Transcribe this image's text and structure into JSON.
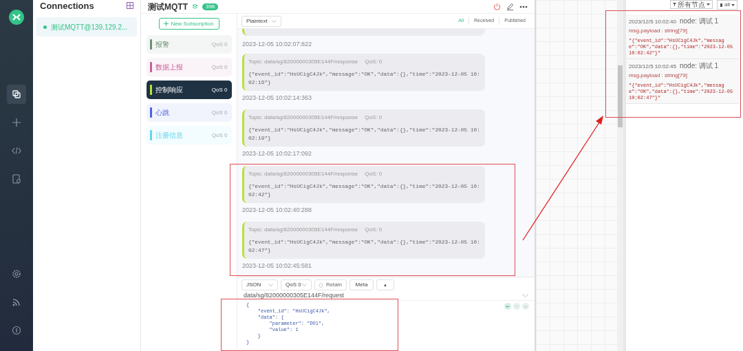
{
  "nav": {
    "items": [
      {
        "kind": "connections",
        "selected": true
      },
      {
        "kind": "new",
        "selected": false
      },
      {
        "kind": "script",
        "selected": false
      },
      {
        "kind": "log",
        "selected": false
      },
      {
        "kind": "settings",
        "selected": false
      },
      {
        "kind": "feed",
        "selected": false
      },
      {
        "kind": "about",
        "selected": false
      }
    ]
  },
  "connections": {
    "title": "Connections",
    "items": [
      {
        "name": "测试MQTT@139.129.2...",
        "connected": true,
        "selected": true
      }
    ]
  },
  "connection_header": {
    "title": "测试MQTT",
    "message_count": "396"
  },
  "subscriptions": {
    "new_button": "New Subscription",
    "items": [
      {
        "topic": "报警",
        "qos": "QoS 0",
        "color": "#6b8f71",
        "selected": false
      },
      {
        "topic": "数据上报",
        "qos": "QoS 0",
        "color": "#c5609a",
        "selected": false
      },
      {
        "topic": "控制响应",
        "qos": "QoS 0",
        "color": "#b5e23a",
        "selected": true
      },
      {
        "topic": "心跳",
        "qos": "QoS 0",
        "color": "#4b63e0",
        "selected": false
      },
      {
        "topic": "注册信息",
        "qos": "QoS 0",
        "color": "#62d4f2",
        "selected": false
      }
    ]
  },
  "message_filter": {
    "format": "Plaintext",
    "tabs": [
      {
        "label": "All",
        "selected": true
      },
      {
        "label": "Received",
        "selected": false
      },
      {
        "label": "Published",
        "selected": false
      }
    ]
  },
  "earlier_message_time": "2023-12-05 10:02:07:822",
  "messages": [
    {
      "topic": "Topic: data/sg/82000000305E144F/response",
      "qos": "QoS: 0",
      "payload": "{\"event_id\":\"HsUCigC4Jk\",\"message\":\"OK\",\"data\":{},\"time\":\"2023-12-05 10:02:16\"}",
      "time": "2023-12-05 10:02:14:363"
    },
    {
      "topic": "Topic: data/sg/82000000305E144F/response",
      "qos": "QoS: 0",
      "payload": "{\"event_id\":\"HsUCigC4Jk\",\"message\":\"OK\",\"data\":{},\"time\":\"2023-12-05 10:02:19\"}",
      "time": "2023-12-05 10:02:17:092"
    },
    {
      "topic": "Topic: data/sg/82000000305E144F/response",
      "qos": "QoS: 0",
      "payload": "{\"event_id\":\"HsUCigC4Jk\",\"message\":\"OK\",\"data\":{},\"time\":\"2023-12-05 10:02:42\"}",
      "time": "2023-12-05 10:02:40:288"
    },
    {
      "topic": "Topic: data/sg/82000000305E144F/response",
      "qos": "QoS: 0",
      "payload": "{\"event_id\":\"HsUCigC4Jk\",\"message\":\"OK\",\"data\":{},\"time\":\"2023-12-05 10:02:47\"}",
      "time": "2023-12-05 10:02:45:581"
    }
  ],
  "composer": {
    "format": "JSON",
    "qos": "QoS 0",
    "retain": {
      "label": "Retain",
      "checked": false
    },
    "meta_button": "Meta",
    "toggle_button": "▲",
    "topic": "data/sg/82000000305E144F/request",
    "code_lines": [
      "{",
      "    \"event_id\": \"HsUCigC4Jk\",",
      "    \"data\": {",
      "        \"parameter\": \"DO1\",",
      "        \"value\": 1",
      "    }",
      "}"
    ]
  },
  "debug_panel": {
    "filter_button": "所有节点",
    "clear_button": "all",
    "entries": [
      {
        "date": "2023/12/5 10:02:40",
        "node": "node: 调试 1",
        "type": "msg.payload : string[79]",
        "payload": "\"{\"event_id\":\"HsUCigC4Jk\",\"message\":\"OK\",\"data\":{},\"time\":\"2023-12-05 10:02:42\"}\""
      },
      {
        "date": "2023/12/5 10:02:45",
        "node": "node: 调试 1",
        "type": "msg.payload : string[79]",
        "payload": "\"{\"event_id\":\"HsUCigC4Jk\",\"message\":\"OK\",\"data\":{},\"time\":\"2023-12-05 10:02:47\"}\""
      }
    ]
  }
}
